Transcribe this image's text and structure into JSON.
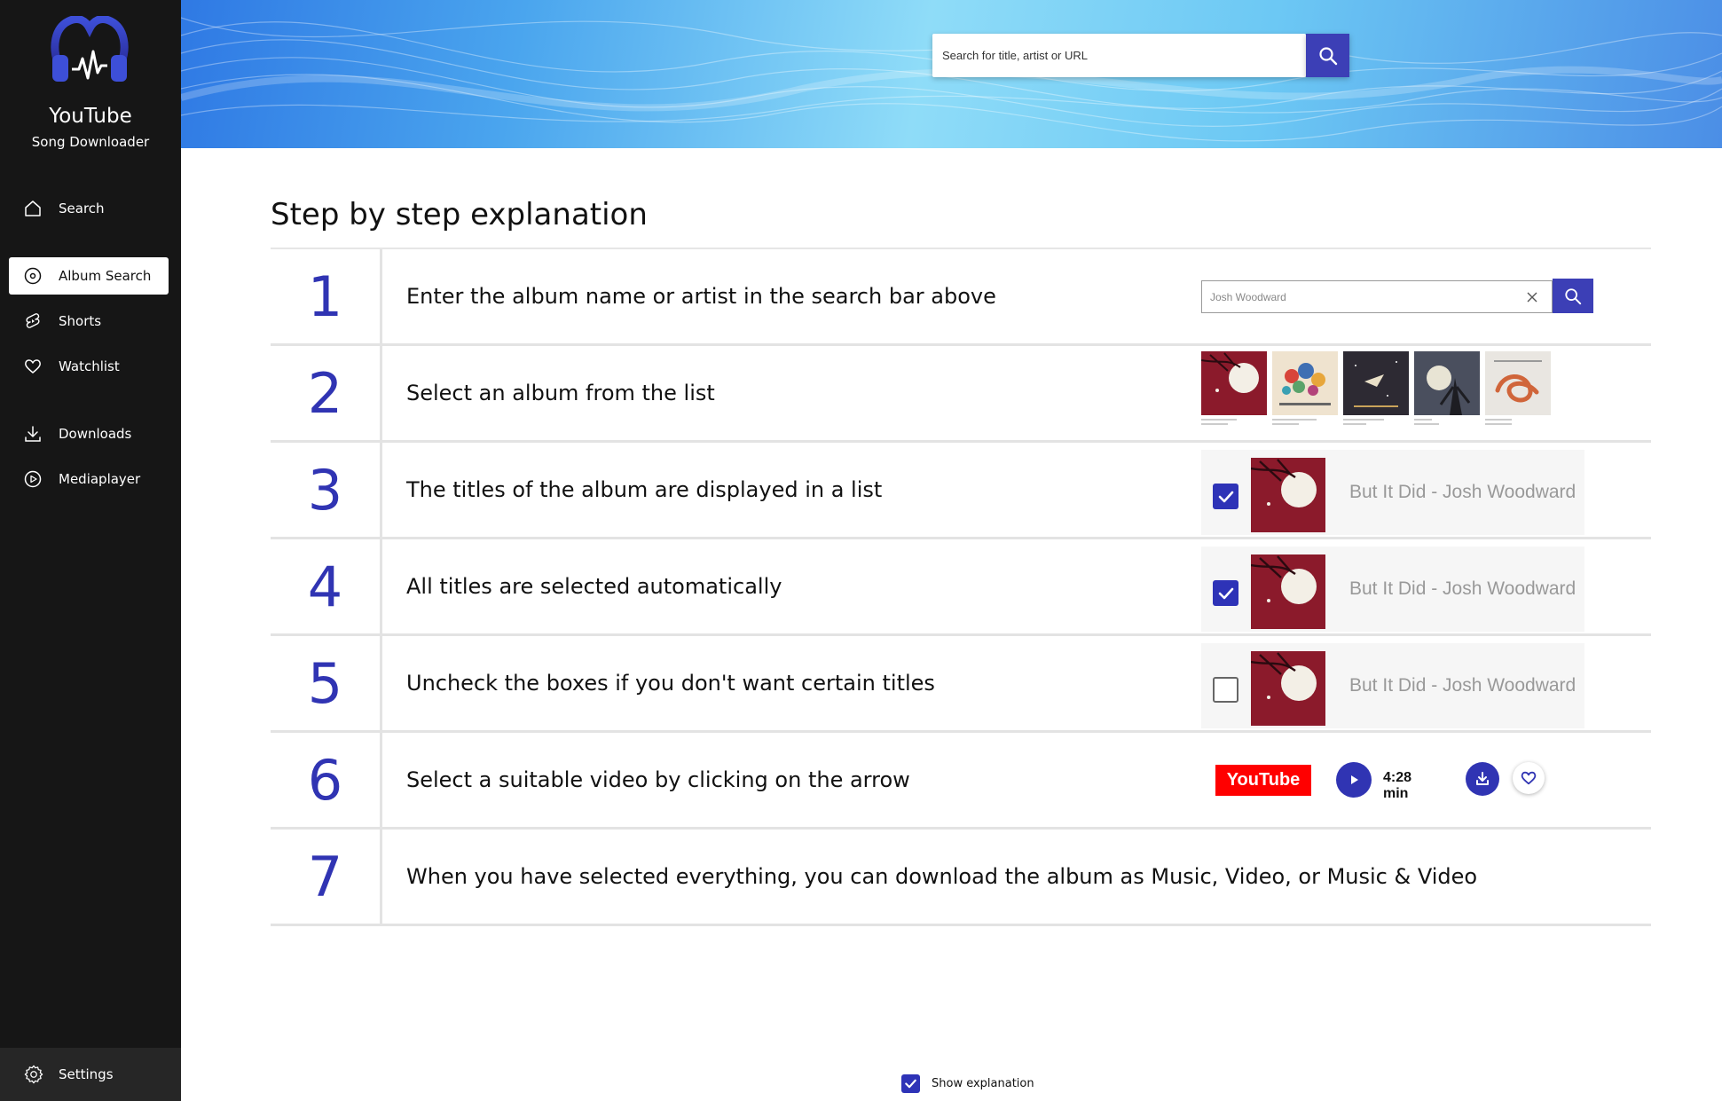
{
  "app": {
    "title": "YouTube",
    "subtitle": "Song Downloader"
  },
  "sidebar": {
    "items": [
      {
        "label": "Search",
        "icon": "home-icon"
      },
      {
        "label": "Album Search",
        "icon": "disc-icon",
        "active": true
      },
      {
        "label": "Shorts",
        "icon": "shorts-icon"
      },
      {
        "label": "Watchlist",
        "icon": "heart-icon"
      },
      {
        "label": "Downloads",
        "icon": "download-icon"
      },
      {
        "label": "Mediaplayer",
        "icon": "play-circle-icon"
      }
    ],
    "settings_label": "Settings"
  },
  "header": {
    "search_placeholder": "Search for title, artist or URL"
  },
  "main": {
    "title": "Step by step explanation",
    "steps": [
      {
        "num": "1",
        "text": "Enter the album name or artist in the search bar above"
      },
      {
        "num": "2",
        "text": "Select an album from the list"
      },
      {
        "num": "3",
        "text": "The titles of the album are displayed in a list"
      },
      {
        "num": "4",
        "text": "All titles are selected automatically"
      },
      {
        "num": "5",
        "text": "Uncheck the boxes if you don't want certain titles"
      },
      {
        "num": "6",
        "text": "Select a suitable video by clicking on the arrow"
      },
      {
        "num": "7",
        "text": "When you have selected everything, you can download the album as Music, Video, or Music & Video"
      }
    ]
  },
  "demo": {
    "search_value": "Josh Woodward",
    "track_title": "But It Did - Josh Woodward",
    "youtube_label": "YouTube",
    "duration": "4:28 min"
  },
  "footer": {
    "show_explanation_label": "Show explanation",
    "show_explanation_checked": true
  },
  "colors": {
    "accent": "#3034b3",
    "sidebar": "#161616",
    "youtube_red": "#ff0000"
  }
}
